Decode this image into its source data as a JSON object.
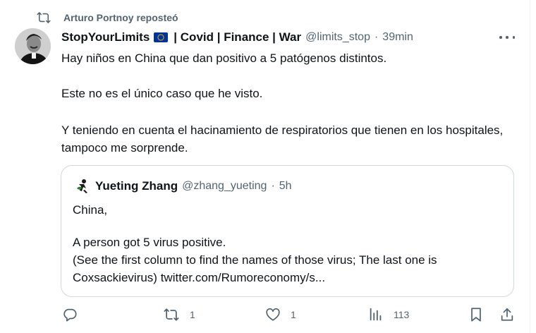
{
  "repost": {
    "icon": "repost-icon",
    "label": "Arturo Portnoy reposteó"
  },
  "tweet": {
    "author_name": "StopYourLimits",
    "flag_icon": "eu-flag-icon",
    "author_name_rest": "| Covid | Finance | War",
    "handle": "@limits_stop",
    "separator": "·",
    "time": "39min",
    "more_icon": "more-icon",
    "lines": [
      "Hay niños en China que dan positivo a 5 patógenos distintos.",
      "Este no es el único caso que he visto.",
      "Y teniendo en cuenta el hacinamiento de respiratorios que tienen en los hospitales, tampoco me sorprende."
    ]
  },
  "quote": {
    "author_name": "Yueting Zhang",
    "handle": "@zhang_yueting",
    "separator": "·",
    "time": "5h",
    "line1": "China,",
    "line2": "A person got 5 virus positive.",
    "line3": "(See the first column to find the names of those virus; The last one is Coxsackievirus) twitter.com/Rumoreconomy/s..."
  },
  "actions": {
    "reply_icon": "reply-icon",
    "repost_icon": "repost-icon",
    "repost_count": "1",
    "like_icon": "heart-icon",
    "like_count": "1",
    "views_icon": "views-icon",
    "views_count": "113",
    "bookmark_icon": "bookmark-icon",
    "share_icon": "share-icon"
  },
  "colors": {
    "text": "#0f1419",
    "secondary": "#536471",
    "border": "#cfd9de",
    "eu_blue": "#003399",
    "eu_gold": "#ffcc00"
  }
}
